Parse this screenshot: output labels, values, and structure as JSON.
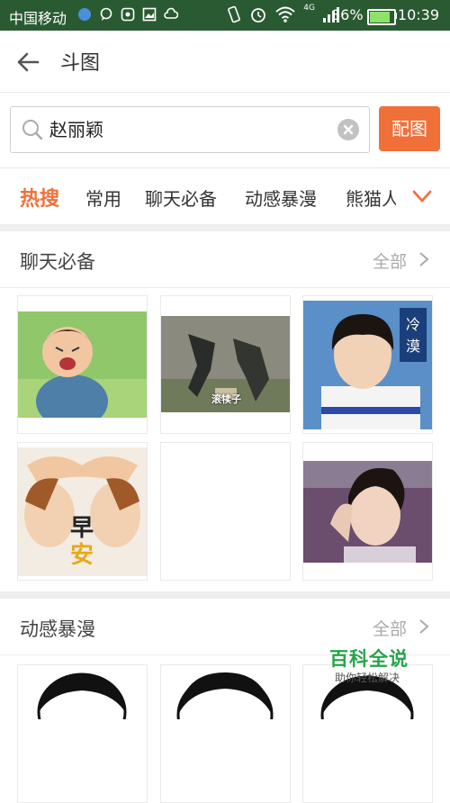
{
  "status_bar": {
    "carrier": "中国移动",
    "network": "4G",
    "battery": "86%",
    "battery_level": 0.86,
    "time": "10:39"
  },
  "header": {
    "title": "斗图"
  },
  "search": {
    "value": "赵丽颖",
    "button": "配图"
  },
  "tabs": [
    {
      "label": "热搜",
      "active": true
    },
    {
      "label": "常用",
      "active": false
    },
    {
      "label": "聊天必备",
      "active": false
    },
    {
      "label": "动感暴漫",
      "active": false
    },
    {
      "label": "熊猫人",
      "active": false
    }
  ],
  "sections": [
    {
      "title": "聊天必备",
      "all_label": "全部",
      "items": [
        {
          "caption": ""
        },
        {
          "caption": "滚犊子"
        },
        {
          "caption": "冷漠"
        },
        {
          "caption": "早安"
        },
        {
          "caption": ""
        },
        {
          "caption": ""
        }
      ]
    },
    {
      "title": "动感暴漫",
      "all_label": "全部"
    }
  ],
  "watermark": {
    "title": "百科全说",
    "subtitle": "助你轻松解决"
  },
  "colors": {
    "accent": "#f0703a",
    "status_bar": "#2a5a32",
    "watermark": "#28a34a"
  }
}
